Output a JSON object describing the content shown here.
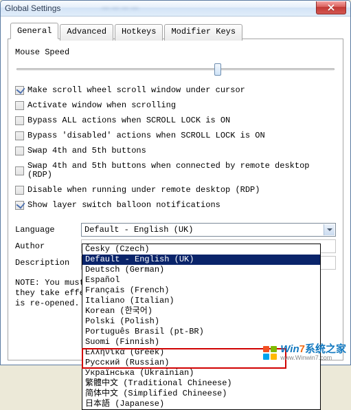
{
  "window": {
    "title": "Global Settings"
  },
  "tabs": {
    "general": "General",
    "advanced": "Advanced",
    "hotkeys": "Hotkeys",
    "modifier": "Modifier Keys"
  },
  "general": {
    "mouse_speed_label": "Mouse Speed",
    "chk_scrollwheel": "Make scroll wheel scroll window under cursor",
    "chk_activate": "Activate window when scrolling",
    "chk_bypass_all": "Bypass ALL actions when SCROLL LOCK is ON",
    "chk_bypass_disabled": "Bypass 'disabled' actions when SCROLL LOCK is ON",
    "chk_swap45": "Swap 4th and 5th buttons",
    "chk_swap45_rdp": "Swap 4th and 5th buttons when connected by remote desktop (RDP)",
    "chk_disable_rdp": "Disable when running under remote desktop (RDP)",
    "chk_balloon": "Show layer switch balloon notifications",
    "language_label": "Language",
    "language_value": "Default - English (UK)",
    "author_label": "Author",
    "description_label": "Description",
    "note_line1": "NOTE: You must",
    "note_line2": "they take effe",
    "note_line3": "is re-opened."
  },
  "languages": [
    "Česky (Czech)",
    "Default - English (UK)",
    "Deutsch (German)",
    "Español",
    "Français (French)",
    "Italiano (Italian)",
    "Korean (한국어)",
    "Polski (Polish)",
    "Português Brasil (pt-BR)",
    "Suomi (Finnish)",
    "Ελληνικά (Greek)",
    "Русский (Russian)",
    "Українська (Ukrainian)",
    "繁體中文 (Traditional Chineese)",
    "简体中文 (Simplified Chineese)",
    "日本語 (Japanese)"
  ],
  "watermark": {
    "brand_w": "W",
    "brand_in": "in",
    "brand_7": "7",
    "brand_rest": "系统之家",
    "url": "www.Winwin7.com"
  }
}
